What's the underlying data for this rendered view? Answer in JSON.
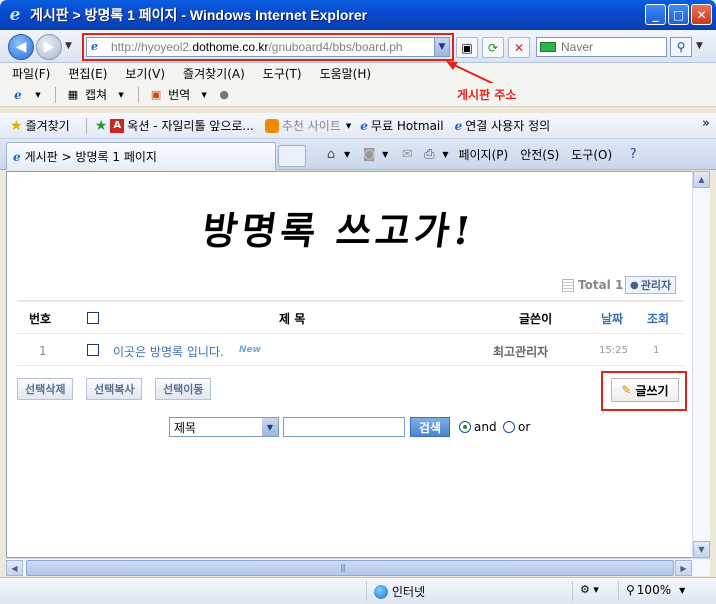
{
  "window": {
    "title": "게시판 > 방명록 1 페이지 - Windows Internet Explorer",
    "min": "_",
    "max": "□",
    "close": "✕"
  },
  "address": {
    "url_prefix": "http://hyoyeol2.",
    "url_domain": "dothome.co.kr",
    "url_path": "/gnuboard4/bbs/board.ph",
    "search_placeholder": "Naver"
  },
  "annotation": {
    "address_label": "게시판 주소"
  },
  "menu": [
    "파일(F)",
    "편집(E)",
    "보기(V)",
    "즐겨찾기(A)",
    "도구(T)",
    "도움말(H)"
  ],
  "toolbar": {
    "capture": "캡쳐",
    "translate": "번역"
  },
  "favorites": {
    "label": "즐겨찾기",
    "items": [
      {
        "label": "옥션 - 자일리톨 앞으로...",
        "muted": false
      },
      {
        "label": "추천 사이트",
        "muted": true
      },
      {
        "label": "무료 Hotmail",
        "muted": false
      },
      {
        "label": "연결 사용자 정의",
        "muted": false
      }
    ]
  },
  "tab": {
    "label": "게시판 > 방명록 1 페이지"
  },
  "commands": {
    "page": "페이지(P)",
    "safety": "안전(S)",
    "tools": "도구(O)"
  },
  "board": {
    "title": "방명록 쓰고가!",
    "total": "Total 1",
    "admin": "관리자",
    "headers": {
      "num": "번호",
      "subject": "제  목",
      "writer": "글쓴이",
      "date": "날짜",
      "hits": "조회"
    },
    "rows": [
      {
        "num": "1",
        "subject": "이곳은 방명록 입니다.",
        "badge": "New",
        "writer": "최고관리자",
        "date": "15:25",
        "hits": "1"
      }
    ],
    "btn_delete": "선택삭제",
    "btn_copy": "선택복사",
    "btn_move": "선택이동",
    "btn_write": "글쓰기",
    "search_field": "제목",
    "search_btn": "검색",
    "radio_and": "and",
    "radio_or": "or"
  },
  "status": {
    "zone": "인터넷",
    "zoom": "100%"
  }
}
